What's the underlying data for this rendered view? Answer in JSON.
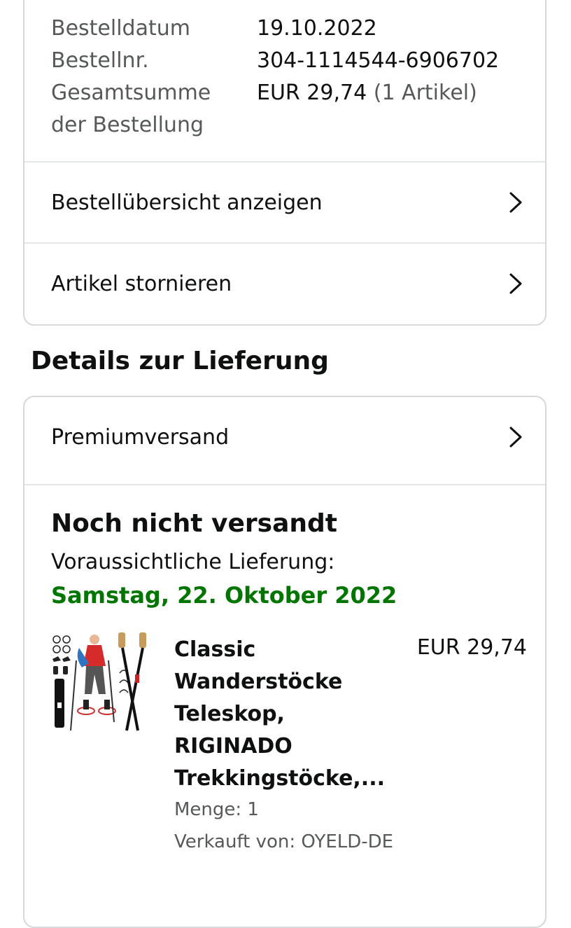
{
  "order_summary": {
    "date_label": "Bestelldatum",
    "date_value": "19.10.2022",
    "number_label": "Bestellnr.",
    "number_value": "304-1114544-6906702",
    "total_label_line1": "Gesamtsumme",
    "total_label_line2": "der Bestellung",
    "total_value": "EUR 29,74",
    "total_items": "(1 Artikel)"
  },
  "actions": {
    "view_order": "Bestellübersicht anzeigen",
    "cancel_items": "Artikel stornieren"
  },
  "delivery": {
    "section_title": "Details zur Lieferung",
    "shipping_method": "Premiumversand",
    "status": "Noch nicht versandt",
    "eta_label": "Voraussichtliche Lieferung:",
    "eta_date": "Samstag, 22. Oktober 2022",
    "eta_color": "#007600"
  },
  "item": {
    "title": "Classic Wanderstöcke Teleskop, RIGINADO Trekkingstöcke,...",
    "price": "EUR 29,74",
    "quantity": "Menge: 1",
    "seller": "Verkauft von: OYELD-DE"
  },
  "icons": {
    "row_chevron": "chevron-right-icon",
    "product_image": "trekking-poles-product-image"
  }
}
